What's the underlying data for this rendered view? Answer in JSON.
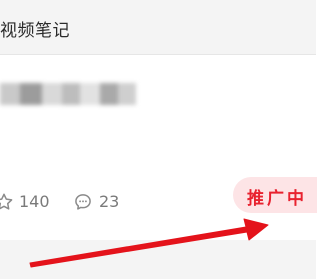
{
  "header": {
    "title": "视频笔记"
  },
  "note": {
    "blurred_text": "",
    "likes": "140",
    "comments": "23"
  },
  "promo": {
    "label": "推广中"
  },
  "icons": {
    "likes": "star-icon",
    "comments": "comment-icon"
  },
  "colors": {
    "promo_text": "#e8222f",
    "promo_bg": "#fde4e6",
    "arrow": "#e4131b",
    "header_bg": "#f4f4f4"
  }
}
